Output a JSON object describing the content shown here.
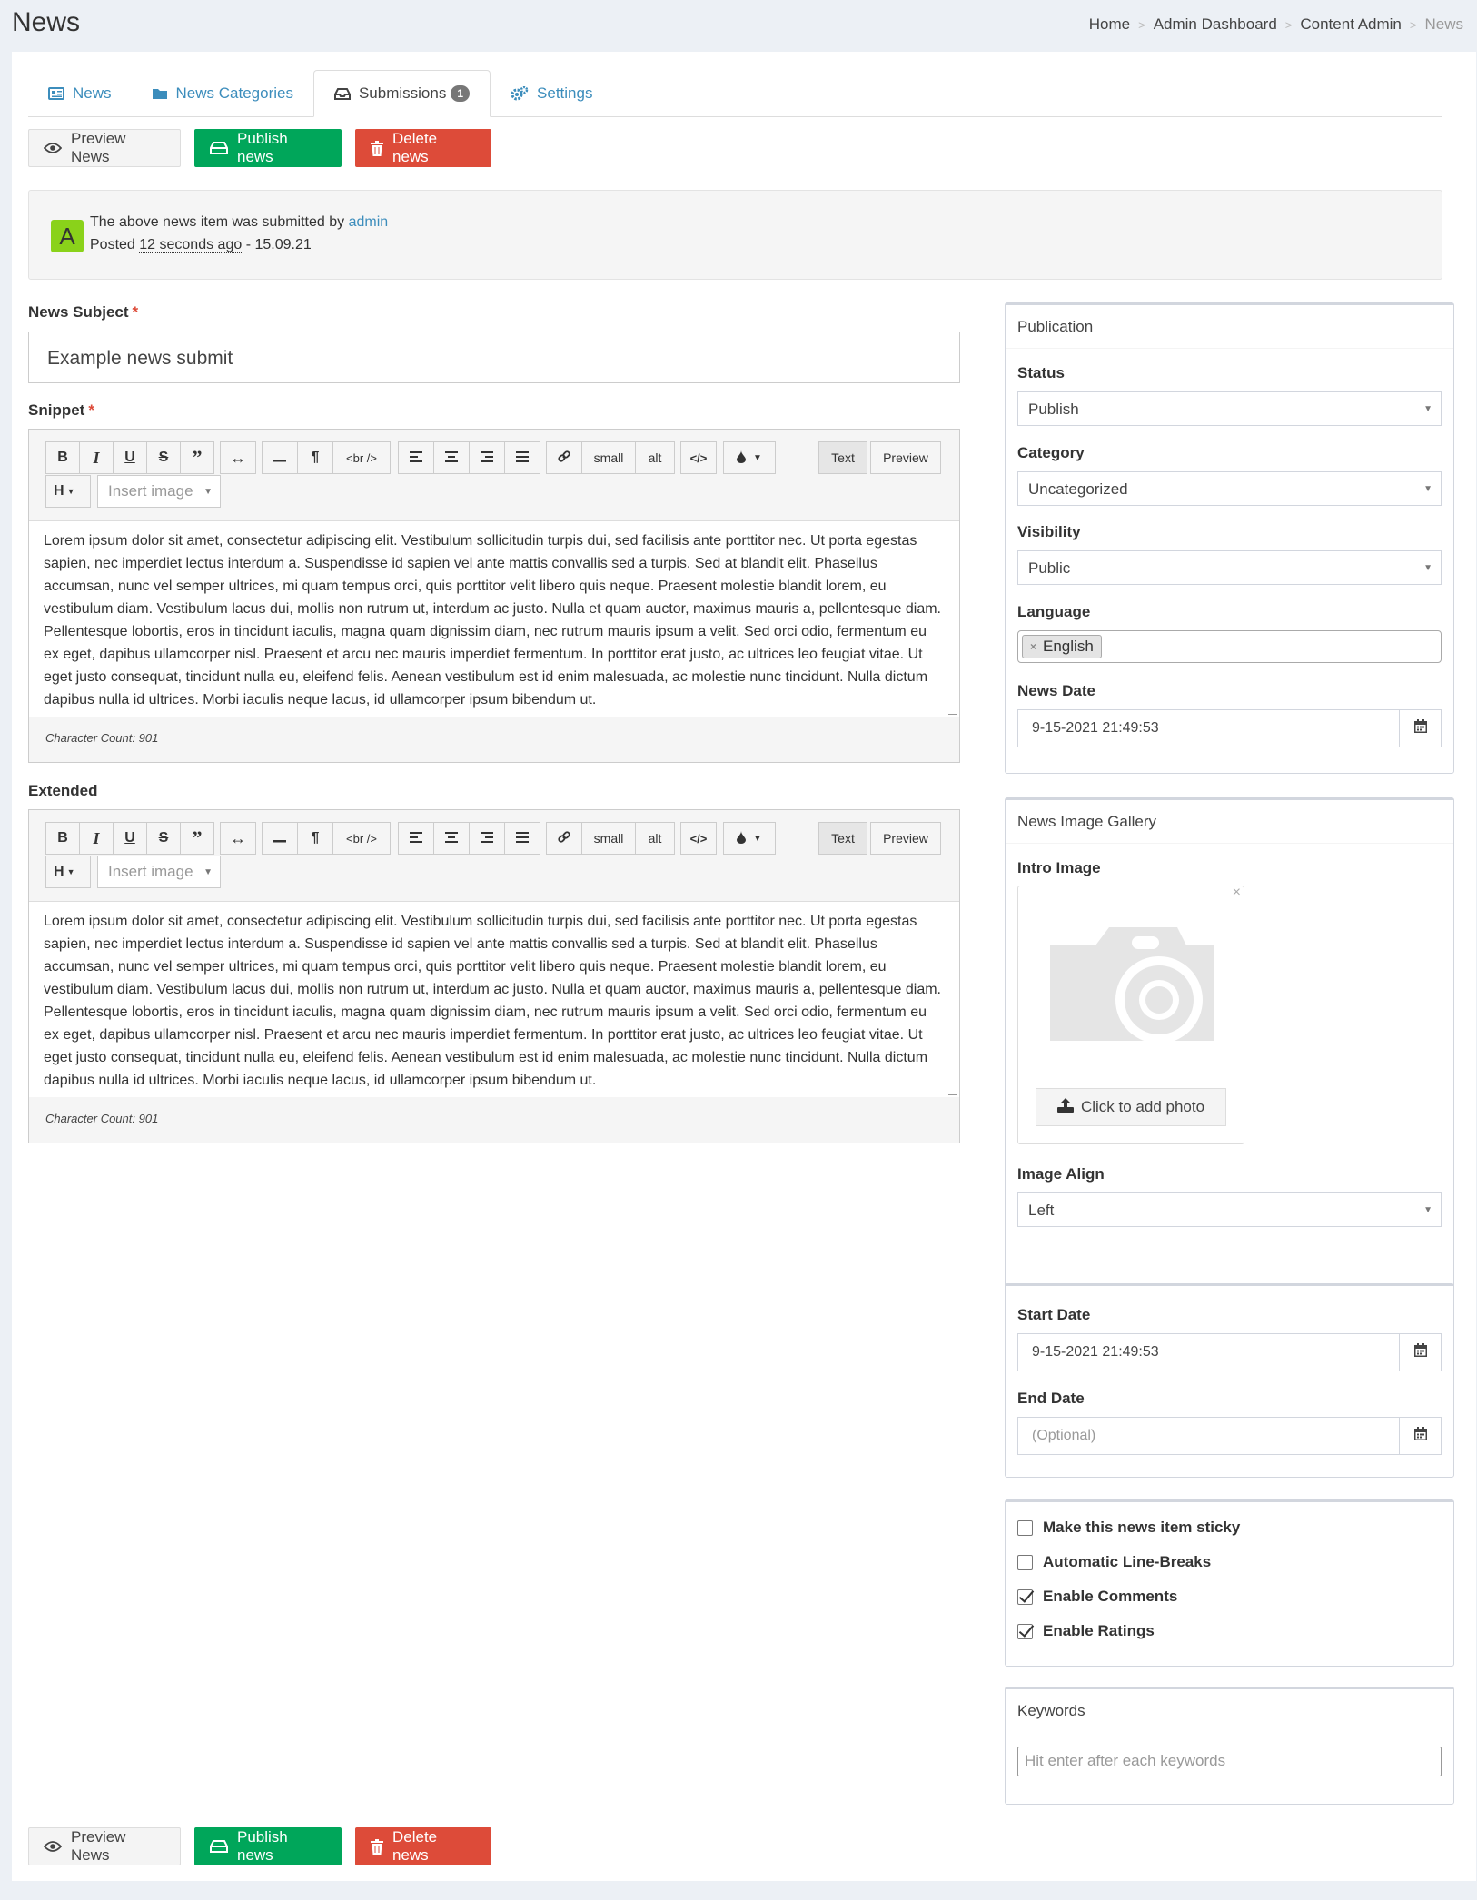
{
  "header": {
    "title": "News",
    "breadcrumb": [
      "Home",
      "Admin Dashboard",
      "Content Admin",
      "News"
    ]
  },
  "tabs": [
    {
      "label": "News",
      "icon": "newspaper-icon"
    },
    {
      "label": "News Categories",
      "icon": "folder-icon"
    },
    {
      "label": "Submissions",
      "icon": "inbox-icon",
      "badge": "1",
      "active": true
    },
    {
      "label": "Settings",
      "icon": "gears-icon"
    }
  ],
  "actions": {
    "preview": "Preview News",
    "publish": "Publish news",
    "delete": "Delete news"
  },
  "notice": {
    "avatar_letter": "A",
    "text": "The above news item was submitted by",
    "user": "admin",
    "posted_label": "Posted",
    "posted_ago": "12 seconds ago",
    "posted_date": "- 15.09.21"
  },
  "form": {
    "subject_label": "News Subject",
    "subject_value": "Example news submit",
    "required_mark": "*",
    "snippet_label": "Snippet",
    "extended_label": "Extended"
  },
  "editor": {
    "buttons": {
      "bold": "B",
      "italic": "I",
      "underline": "U",
      "strike": "S",
      "br": "<br />",
      "small": "small",
      "alt": "alt",
      "text_tab": "Text",
      "preview_tab": "Preview",
      "heading": "H"
    },
    "insert_image_placeholder": "Insert image",
    "snippet_text": "Lorem ipsum dolor sit amet, consectetur adipiscing elit. Vestibulum sollicitudin turpis dui, sed facilisis ante porttitor nec. Ut porta egestas sapien, nec imperdiet lectus interdum a. Suspendisse id sapien vel ante mattis convallis sed a turpis. Sed at blandit elit. Phasellus accumsan, nunc vel semper ultrices, mi quam tempus orci, quis porttitor velit libero quis neque. Praesent molestie blandit lorem, eu vestibulum diam. Vestibulum lacus dui, mollis non rutrum ut, interdum ac justo. Nulla et quam auctor, maximus mauris a, pellentesque diam. Pellentesque lobortis, eros in tincidunt iaculis, magna quam dignissim diam, nec rutrum mauris ipsum a velit. Sed orci odio, fermentum eu ex eget, dapibus ullamcorper nisl. Praesent et arcu nec mauris imperdiet fermentum. In porttitor erat justo, ac ultrices leo feugiat vitae. Ut eget justo consequat, tincidunt nulla eu, eleifend felis. Aenean vestibulum est id enim malesuada, ac molestie nunc tincidunt. Nulla dictum dapibus nulla id ultrices. Morbi iaculis neque lacus, id ullamcorper ipsum bibendum ut.",
    "extended_text": "Lorem ipsum dolor sit amet, consectetur adipiscing elit. Vestibulum sollicitudin turpis dui, sed facilisis ante porttitor nec. Ut porta egestas sapien, nec imperdiet lectus interdum a. Suspendisse id sapien vel ante mattis convallis sed a turpis. Sed at blandit elit. Phasellus accumsan, nunc vel semper ultrices, mi quam tempus orci, quis porttitor velit libero quis neque. Praesent molestie blandit lorem, eu vestibulum diam. Vestibulum lacus dui, mollis non rutrum ut, interdum ac justo. Nulla et quam auctor, maximus mauris a, pellentesque diam. Pellentesque lobortis, eros in tincidunt iaculis, magna quam dignissim diam, nec rutrum mauris ipsum a velit. Sed orci odio, fermentum eu ex eget, dapibus ullamcorper nisl. Praesent et arcu nec mauris imperdiet fermentum. In porttitor erat justo, ac ultrices leo feugiat vitae. Ut eget justo consequat, tincidunt nulla eu, eleifend felis. Aenean vestibulum est id enim malesuada, ac molestie nunc tincidunt. Nulla dictum dapibus nulla id ultrices. Morbi iaculis neque lacus, id ullamcorper ipsum bibendum ut.",
    "snippet_count": "Character Count: 901",
    "extended_count": "Character Count: 901"
  },
  "publication": {
    "title": "Publication",
    "status_label": "Status",
    "status_value": "Publish",
    "category_label": "Category",
    "category_value": "Uncategorized",
    "visibility_label": "Visibility",
    "visibility_value": "Public",
    "language_label": "Language",
    "language_tag": "English",
    "date_label": "News Date",
    "date_value": "9-15-2021 21:49:53"
  },
  "gallery": {
    "title": "News Image Gallery",
    "intro_label": "Intro Image",
    "close": "×",
    "add_photo": "Click to add photo",
    "align_label": "Image Align",
    "align_value": "Left"
  },
  "schedule": {
    "start_label": "Start Date",
    "start_value": "9-15-2021 21:49:53",
    "end_label": "End Date",
    "end_placeholder": "(Optional)"
  },
  "options": [
    {
      "label": "Make this news item sticky",
      "checked": false
    },
    {
      "label": "Automatic Line-Breaks",
      "checked": false
    },
    {
      "label": "Enable Comments",
      "checked": true
    },
    {
      "label": "Enable Ratings",
      "checked": true
    }
  ],
  "keywords": {
    "title": "Keywords",
    "placeholder": "Hit enter after each keywords"
  },
  "colors": {
    "success": "#00a65a",
    "danger": "#dd4b39",
    "link": "#3c8dbc",
    "avatar": "#8ad21a"
  }
}
